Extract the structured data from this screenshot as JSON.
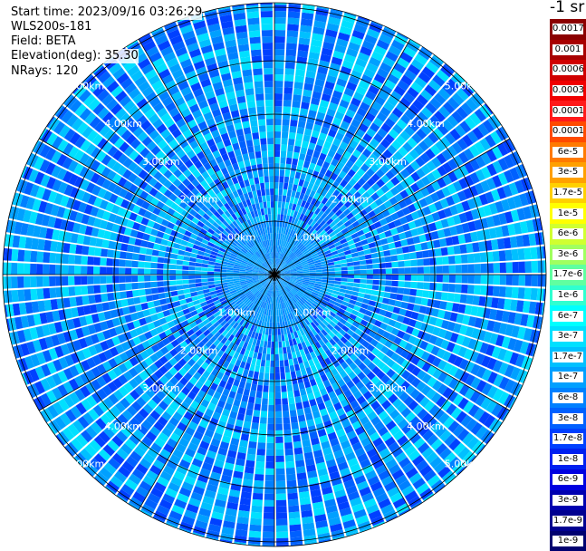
{
  "info": {
    "start_time": "Start time: 2023/09/16 03:26:29",
    "instrument": "WLS200s-181",
    "field": "Field: BETA",
    "elevation": "Elevation(deg): 35.30",
    "nrays": "NRays: 120"
  },
  "colorbar": {
    "unit_title": "-1 sr",
    "entries": [
      {
        "label": "0.0017",
        "color": "#8b0000"
      },
      {
        "label": "0.001",
        "color": "#a80000"
      },
      {
        "label": "0.0006",
        "color": "#d00000"
      },
      {
        "label": "0.0003",
        "color": "#f00000"
      },
      {
        "label": "0.00017",
        "color": "#ff1a1a"
      },
      {
        "label": "0.0001",
        "color": "#ff4a00"
      },
      {
        "label": "6e-5",
        "color": "#ff7a00"
      },
      {
        "label": "3e-5",
        "color": "#ffa000"
      },
      {
        "label": "1.7e-5",
        "color": "#ffd000"
      },
      {
        "label": "1e-5",
        "color": "#ffff00"
      },
      {
        "label": "6e-6",
        "color": "#d0ff30"
      },
      {
        "label": "3e-6",
        "color": "#a0ff60"
      },
      {
        "label": "1.7e-6",
        "color": "#60ffa0"
      },
      {
        "label": "1e-6",
        "color": "#30ffd0"
      },
      {
        "label": "6e-7",
        "color": "#00ffff"
      },
      {
        "label": "3e-7",
        "color": "#00e0ff"
      },
      {
        "label": "1.7e-7",
        "color": "#00c0ff"
      },
      {
        "label": "1e-7",
        "color": "#00a0ff"
      },
      {
        "label": "6e-8",
        "color": "#0080ff"
      },
      {
        "label": "3e-8",
        "color": "#0060ff"
      },
      {
        "label": "1.7e-8",
        "color": "#0040ff"
      },
      {
        "label": "1e-8",
        "color": "#0020f0"
      },
      {
        "label": "6e-9",
        "color": "#0000e0"
      },
      {
        "label": "3e-9",
        "color": "#0000b0"
      },
      {
        "label": "1.7e-9",
        "color": "#000090"
      },
      {
        "label": "1e-9",
        "color": "#000070"
      }
    ]
  },
  "rings": {
    "labels": [
      "1.00km",
      "2.00km",
      "3.00km",
      "4.00km",
      "5.00km"
    ],
    "values_km": [
      1,
      2,
      3,
      4,
      5
    ]
  },
  "scan": {
    "rays": 120,
    "palette": [
      "#00c0ff",
      "#00a0ff",
      "#0080ff",
      "#0060ff",
      "#00e0ff",
      "#0040ff"
    ]
  }
}
